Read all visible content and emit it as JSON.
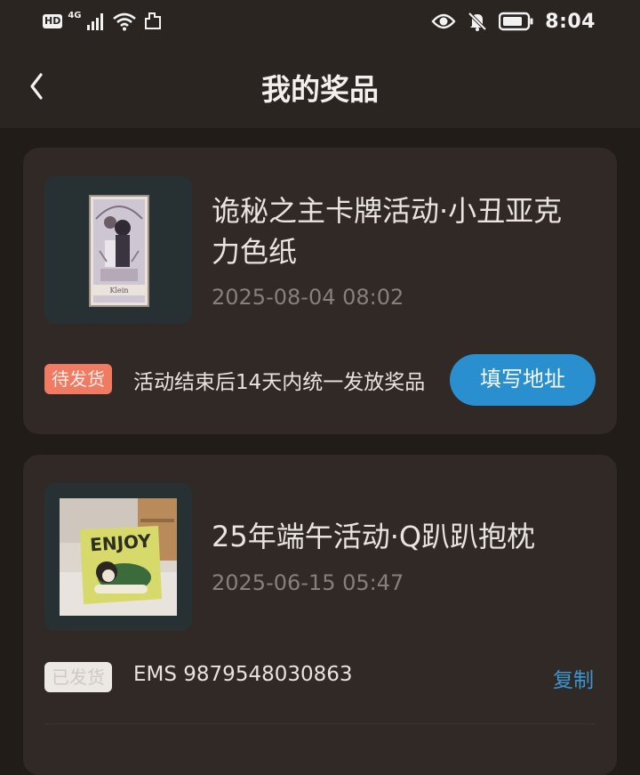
{
  "status_bar": {
    "hd": "HD",
    "network": "4G",
    "time": "8:04",
    "icons": [
      "signal-icon",
      "wifi-icon",
      "nfc-icon",
      "eye-icon",
      "bell-off-icon",
      "battery-icon"
    ]
  },
  "header": {
    "title": "我的奖品",
    "back_icon": "chevron-left-icon"
  },
  "colors": {
    "background": "#221c19",
    "card": "#302926",
    "accent": "#2a8fcf",
    "pending": "#f07a62"
  },
  "prizes": [
    {
      "name": "诡秘之主卡牌活动·小丑亚克力色纸",
      "date": "2025-08-04 08:02",
      "status": "待发货",
      "note": "活动结束后14天内统一发放奖品",
      "action": "填写地址",
      "card_label": "Klein",
      "image_icon": "tarot-card-image"
    },
    {
      "name": "25年端午活动·Q趴趴抱枕",
      "date": "2025-06-15 05:47",
      "status": "已发货",
      "note": "EMS 9879548030863",
      "action": "复制",
      "pillow_text": "ENJOY",
      "image_icon": "pillow-photo-image"
    }
  ]
}
